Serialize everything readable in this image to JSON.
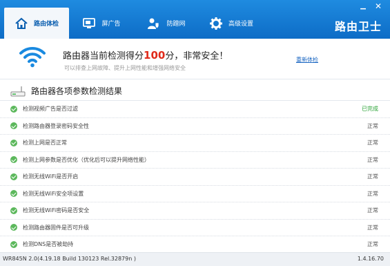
{
  "window": {
    "minimize_glyph": "▁",
    "close_glyph": "✕"
  },
  "nav": {
    "tabs": [
      {
        "label": "路由体检",
        "icon": "home-icon"
      },
      {
        "label": "屏广告",
        "icon": "monitor-icon"
      },
      {
        "label": "防蹭网",
        "icon": "user-shield-icon"
      },
      {
        "label": "高级设置",
        "icon": "gear-icon"
      }
    ],
    "brand": "路由卫士"
  },
  "score": {
    "prefix": "路由器当前检测得分",
    "value": "100",
    "suffix": "分，非常安全！",
    "subtitle": "可以排查上网故障、提升上网性能和增强网络安全",
    "recheck_label": "重新体检"
  },
  "results": {
    "title": "路由器各项参数检测结果",
    "items": [
      {
        "label": "检测视频广告是否过滤",
        "status": "已完成",
        "done": true
      },
      {
        "label": "检测路由器登录密码安全性",
        "status": "正常",
        "done": false
      },
      {
        "label": "检测上网是否正常",
        "status": "正常",
        "done": false
      },
      {
        "label": "检测上网参数是否优化（优化后可以提升网络性能）",
        "status": "正常",
        "done": false
      },
      {
        "label": "检测无线WiFi是否开启",
        "status": "正常",
        "done": false
      },
      {
        "label": "检测无线WiFi安全项设置",
        "status": "正常",
        "done": false
      },
      {
        "label": "检测无线WiFi密码是否安全",
        "status": "正常",
        "done": false
      },
      {
        "label": "检测路由器固件是否可升级",
        "status": "正常",
        "done": false
      },
      {
        "label": "检测DNS是否被劫持",
        "status": "正常",
        "done": false
      }
    ]
  },
  "footer": {
    "device": "WR845N 2.0(4.19.18 Build 130123 Rel.32879n )",
    "version": "1.4.16.70"
  },
  "colors": {
    "header": "#1a80d8",
    "score_number": "#e02a1a",
    "done_status": "#2aa336",
    "check": "#5cb85c"
  }
}
